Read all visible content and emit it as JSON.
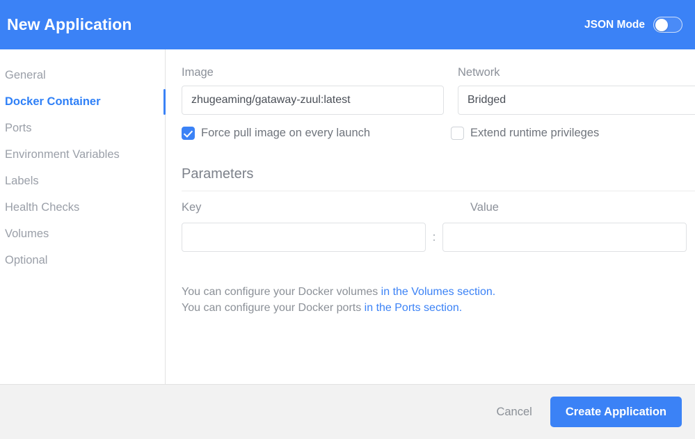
{
  "header": {
    "title": "New Application",
    "json_mode_label": "JSON Mode",
    "json_mode_enabled": false
  },
  "sidebar": {
    "items": [
      {
        "label": "General",
        "active": false
      },
      {
        "label": "Docker Container",
        "active": true
      },
      {
        "label": "Ports",
        "active": false
      },
      {
        "label": "Environment Variables",
        "active": false
      },
      {
        "label": "Labels",
        "active": false
      },
      {
        "label": "Health Checks",
        "active": false
      },
      {
        "label": "Volumes",
        "active": false
      },
      {
        "label": "Optional",
        "active": false
      }
    ]
  },
  "main": {
    "image": {
      "label": "Image",
      "value": "zhugeaming/gataway-zuul:latest",
      "placeholder": ""
    },
    "network": {
      "label": "Network",
      "value": "Bridged"
    },
    "force_pull": {
      "label": "Force pull image on every launch",
      "checked": true
    },
    "extend_privileges": {
      "label": "Extend runtime privileges",
      "checked": false
    },
    "parameters": {
      "title": "Parameters",
      "key_label": "Key",
      "value_label": "Value",
      "key_value": "",
      "value_value": "",
      "key_placeholder": "",
      "value_placeholder": "",
      "separator": ":",
      "add_label": "+"
    },
    "help": {
      "line1_prefix": "You can configure your Docker volumes ",
      "line1_link": "in the Volumes section.",
      "line2_prefix": "You can configure your Docker ports ",
      "line2_link": "in the Ports section."
    }
  },
  "footer": {
    "cancel_label": "Cancel",
    "create_label": "Create Application"
  },
  "colors": {
    "accent": "#3b82f6",
    "link": "#3b82f6",
    "muted_text": "#8b9097",
    "footer_bg": "#f2f2f2"
  }
}
